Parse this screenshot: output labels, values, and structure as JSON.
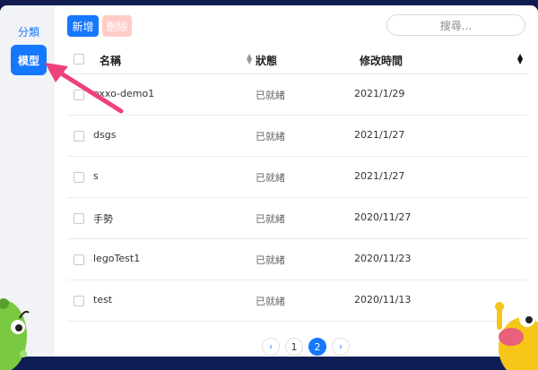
{
  "sidebar": {
    "items": [
      {
        "label": "分類",
        "active": false
      },
      {
        "label": "模型",
        "active": true
      }
    ]
  },
  "toolbar": {
    "add_label": "新增",
    "delete_label": "刪除",
    "search_placeholder": "搜尋..."
  },
  "table": {
    "headers": {
      "name": "名稱",
      "status": "狀態",
      "time": "修改時間"
    },
    "rows": [
      {
        "name": "oxxo-demo1",
        "status": "已就緒",
        "time": "2021/1/29"
      },
      {
        "name": "dsgs",
        "status": "已就緒",
        "time": "2021/1/27"
      },
      {
        "name": "s",
        "status": "已就緒",
        "time": "2021/1/27"
      },
      {
        "name": "手勢",
        "status": "已就緒",
        "time": "2020/11/27"
      },
      {
        "name": "legoTest1",
        "status": "已就緒",
        "time": "2020/11/23"
      },
      {
        "name": "test",
        "status": "已就緒",
        "time": "2020/11/13"
      }
    ]
  },
  "pagination": {
    "prev": "‹",
    "pages": [
      "1",
      "2"
    ],
    "current": "2",
    "next": "›"
  },
  "colors": {
    "accent": "#1677ff",
    "annotation_arrow": "#f0407a",
    "background": "#0f1d55"
  }
}
